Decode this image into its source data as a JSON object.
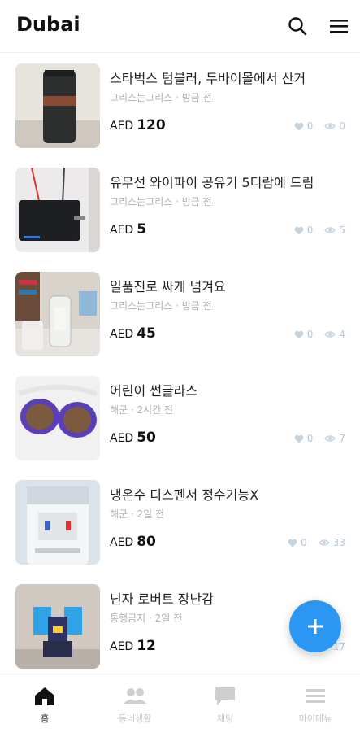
{
  "header": {
    "title": "Dubai"
  },
  "items": [
    {
      "title": "스타벅스 텀블러, 두바이몰에서 산거",
      "meta": "그리스는그리스 · 방금 전",
      "currency": "AED",
      "price": "120",
      "likes": "0",
      "views": "0"
    },
    {
      "title": "유무선 와이파이 공유기 5디람에 드림",
      "meta": "그리스는그리스 · 방금 전",
      "currency": "AED",
      "price": "5",
      "likes": "0",
      "views": "5"
    },
    {
      "title": "일품진로 싸게 넘겨요",
      "meta": "그리스는그리스 · 방금 전",
      "currency": "AED",
      "price": "45",
      "likes": "0",
      "views": "4"
    },
    {
      "title": "어린이 썬글라스",
      "meta": "해군 · 2시간 전",
      "currency": "AED",
      "price": "50",
      "likes": "0",
      "views": "7"
    },
    {
      "title": "냉온수 디스펜서 정수기능X",
      "meta": "해군 · 2일 전",
      "currency": "AED",
      "price": "80",
      "likes": "0",
      "views": "33"
    },
    {
      "title": "닌자 로버트 장난감",
      "meta": "통행금지 · 2일 전",
      "currency": "AED",
      "price": "12",
      "likes": "",
      "views": "17"
    }
  ],
  "tabs": [
    {
      "label": "홈",
      "icon": "home-icon",
      "active": true
    },
    {
      "label": "동네생활",
      "icon": "people-icon"
    },
    {
      "label": "채팅",
      "icon": "chat-icon"
    },
    {
      "label": "마이메뉴",
      "icon": "menu-icon"
    }
  ],
  "colors": {
    "accent": "#2b97f3",
    "muted": "#b0b0b0",
    "stats": "#b7c7d6"
  }
}
